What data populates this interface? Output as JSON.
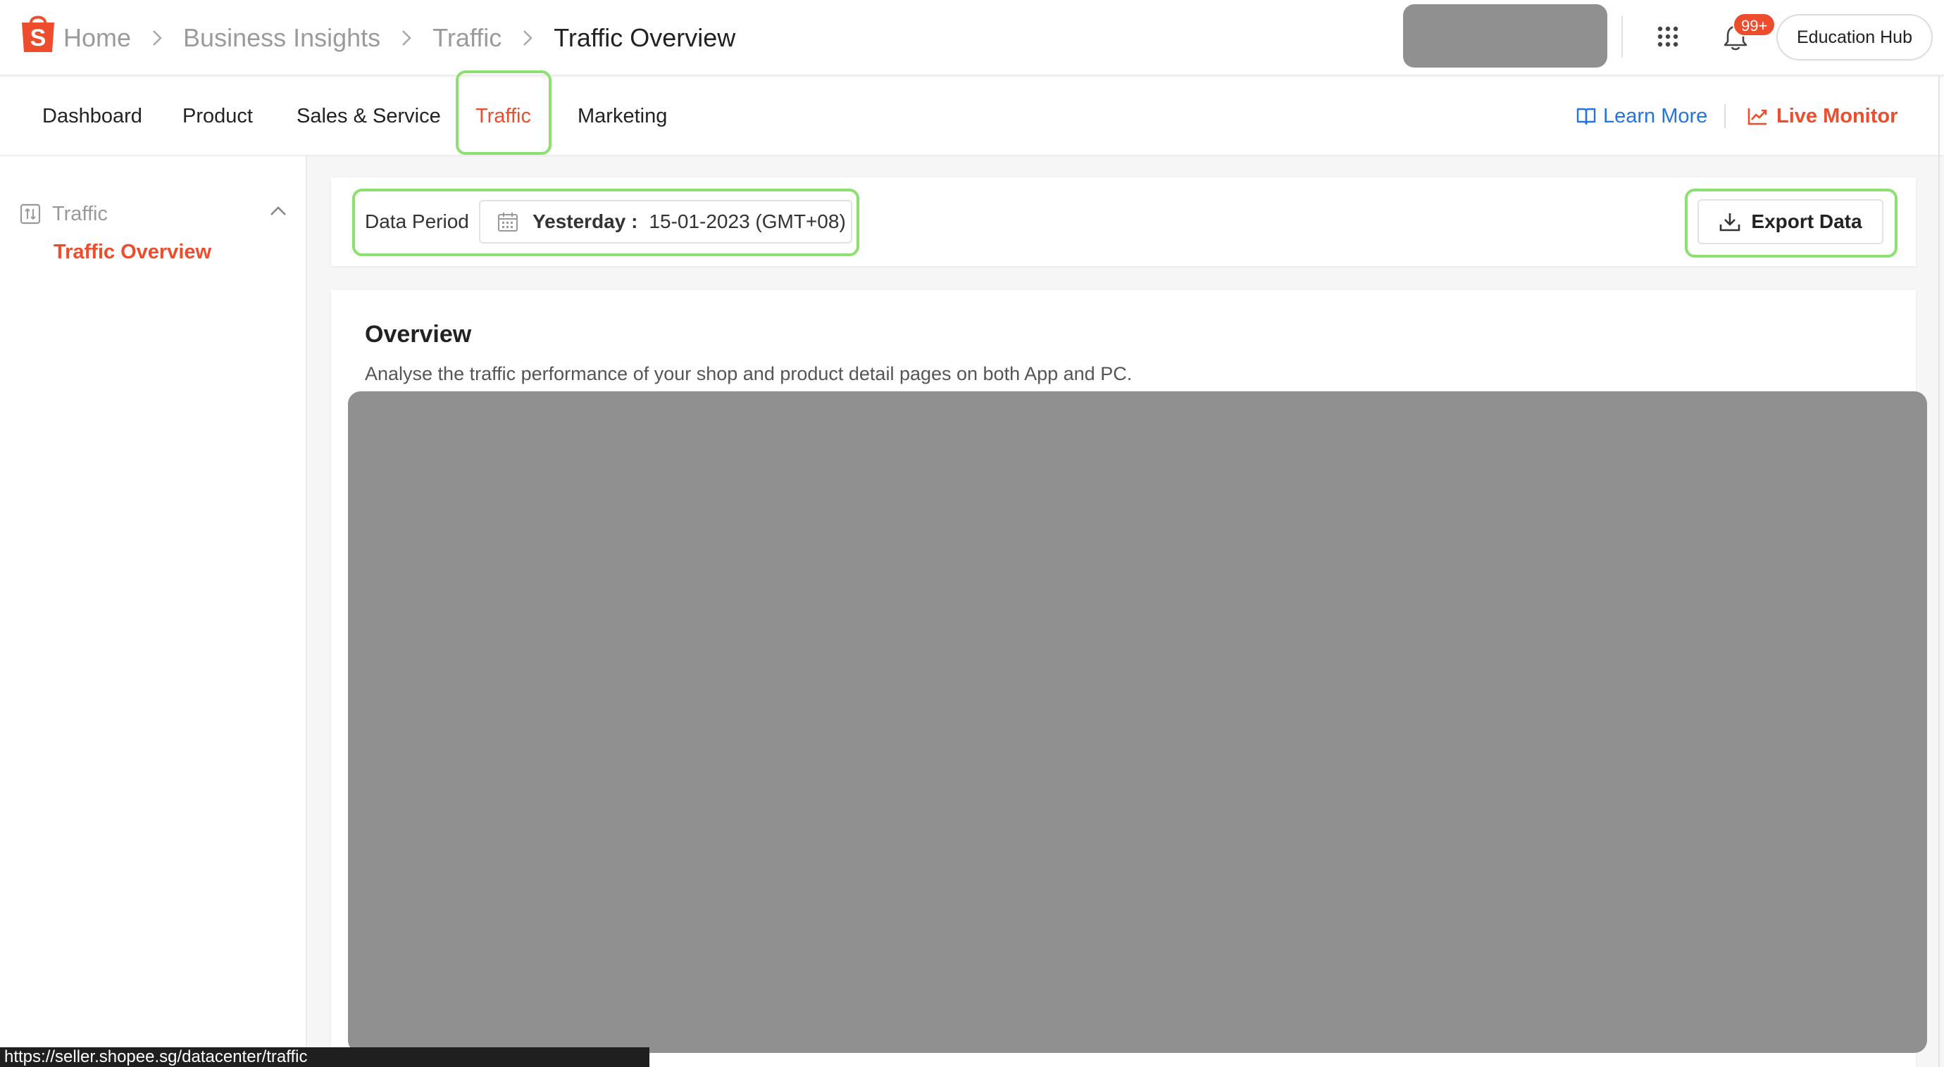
{
  "breadcrumb": {
    "items": [
      "Home",
      "Business Insights",
      "Traffic"
    ],
    "current": "Traffic Overview"
  },
  "header": {
    "notification_badge": "99+",
    "education_hub_label": "Education Hub"
  },
  "nav": {
    "tabs": [
      {
        "label": "Dashboard",
        "active": false
      },
      {
        "label": "Product",
        "active": false
      },
      {
        "label": "Sales & Service",
        "active": false
      },
      {
        "label": "Traffic",
        "active": true
      },
      {
        "label": "Marketing",
        "active": false
      }
    ],
    "learn_more_label": "Learn More",
    "live_monitor_label": "Live Monitor"
  },
  "sidebar": {
    "group_label": "Traffic",
    "items": [
      {
        "label": "Traffic Overview",
        "active": true
      }
    ]
  },
  "filter": {
    "data_period_label": "Data Period",
    "period_name": "Yesterday :",
    "period_value": "15-01-2023 (GMT+08)",
    "export_label": "Export Data"
  },
  "overview": {
    "title": "Overview",
    "description": "Analyse the traffic performance of your shop and product detail pages on both App and PC."
  },
  "status_bar": {
    "url": "https://seller.shopee.sg/datacenter/traffic"
  },
  "colors": {
    "brand": "#ee4d2d",
    "link": "#2673dd",
    "highlight": "#8ce070",
    "redaction": "#909090"
  },
  "icons": {
    "logo": "shopee-bag-logo",
    "apps": "apps-grid-icon",
    "bell": "bell-icon",
    "learn_more": "book-icon",
    "live_monitor": "chart-line-icon",
    "sidebar_group": "traffic-icon",
    "collapse": "chevron-up-icon",
    "calendar": "calendar-icon",
    "export": "download-icon"
  }
}
